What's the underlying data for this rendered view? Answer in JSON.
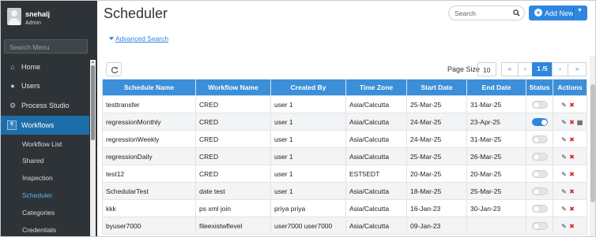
{
  "user": {
    "name": "snehalj",
    "role": "Admin"
  },
  "sidebar": {
    "search_placeholder": "Search Menu",
    "items": [
      {
        "label": "Home",
        "icon": "home-icon"
      },
      {
        "label": "Users",
        "icon": "users-icon"
      },
      {
        "label": "Process Studio",
        "icon": "cogs-icon"
      },
      {
        "label": "Workflows",
        "icon": "workflow-icon"
      }
    ],
    "subitems": [
      {
        "label": "Workflow List"
      },
      {
        "label": "Shared"
      },
      {
        "label": "Inspection"
      },
      {
        "label": "Scheduler"
      },
      {
        "label": "Categories"
      },
      {
        "label": "Credentials"
      }
    ]
  },
  "header": {
    "title": "Scheduler",
    "search_placeholder": "Search",
    "add_label": "Add New",
    "advanced_search": "Advanced Search"
  },
  "pager": {
    "page_size_label": "Page Size",
    "page_size": "10",
    "first": "«",
    "prev": "‹",
    "current": "1 /5",
    "next": "›",
    "last": "»"
  },
  "table": {
    "columns": [
      "Schedule Name",
      "Workflow Name",
      "Created By",
      "Time Zone",
      "Start Date",
      "End Date",
      "Status",
      "Actions"
    ],
    "rows": [
      {
        "schedule": "testtransfer",
        "workflow": "CRED",
        "created_by": "user 1",
        "tz": "Asia/Calcutta",
        "start": "25-Mar-25",
        "end": "31-Mar-25",
        "status": false,
        "calendar": false
      },
      {
        "schedule": "regressionMonthly",
        "workflow": "CRED",
        "created_by": "user 1",
        "tz": "Asia/Calcutta",
        "start": "24-Mar-25",
        "end": "23-Apr-25",
        "status": true,
        "calendar": true
      },
      {
        "schedule": "regressionWeekly",
        "workflow": "CRED",
        "created_by": "user 1",
        "tz": "Asia/Calcutta",
        "start": "24-Mar-25",
        "end": "31-Mar-25",
        "status": false,
        "calendar": false
      },
      {
        "schedule": "regressionDaily",
        "workflow": "CRED",
        "created_by": "user 1",
        "tz": "Asia/Calcutta",
        "start": "25-Mar-25",
        "end": "26-Mar-25",
        "status": false,
        "calendar": false
      },
      {
        "schedule": "test12",
        "workflow": "CRED",
        "created_by": "user 1",
        "tz": "EST5EDT",
        "start": "20-Mar-25",
        "end": "20-Mar-25",
        "status": false,
        "calendar": false
      },
      {
        "schedule": "SchedularTest",
        "workflow": "date test",
        "created_by": "user 1",
        "tz": "Asia/Calcutta",
        "start": "18-Mar-25",
        "end": "25-Mar-25",
        "status": false,
        "calendar": false
      },
      {
        "schedule": "kkk",
        "workflow": "ps xml join",
        "created_by": "priya priya",
        "tz": "Asia/Calcutta",
        "start": "16-Jan-23",
        "end": "30-Jan-23",
        "status": false,
        "calendar": false
      },
      {
        "schedule": "byuser7000",
        "workflow": "fileexistwflevel",
        "created_by": "user7000 user7000",
        "tz": "Asia/Calcutta",
        "start": "09-Jan-23",
        "end": "",
        "status": false,
        "calendar": false
      }
    ]
  },
  "colors": {
    "accent": "#2e86de",
    "sidebar_bg": "#2e3337",
    "header_bg": "#3b8fd8",
    "delete": "#d9262c"
  }
}
